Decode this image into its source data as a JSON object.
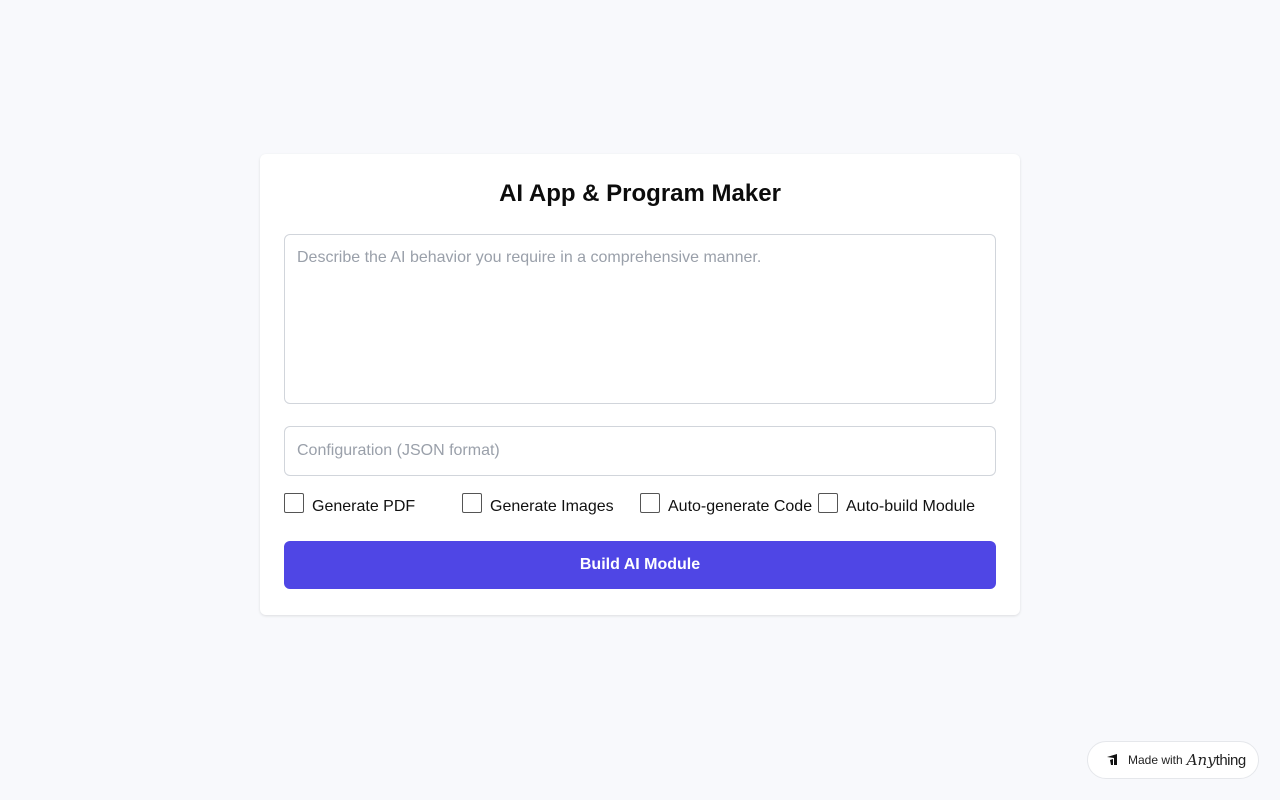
{
  "title": "AI App & Program Maker",
  "prompt": {
    "value": "",
    "placeholder": "Describe the AI behavior you require in a comprehensive manner."
  },
  "config": {
    "value": "",
    "placeholder": "Configuration (JSON format)"
  },
  "options": [
    {
      "label": "Generate PDF",
      "checked": false
    },
    {
      "label": "Generate Images",
      "checked": false
    },
    {
      "label": "Auto-generate Code",
      "checked": false
    },
    {
      "label": "Auto-build Module",
      "checked": false
    }
  ],
  "build_button": {
    "label": "Build AI Module"
  },
  "badge": {
    "text": "Made with",
    "brand_part1": "Any",
    "brand_part2": "thing",
    "icon": "anything-logo-icon"
  },
  "colors": {
    "background": "#f8f9fc",
    "primary": "#4f46e5",
    "card": "#ffffff"
  }
}
